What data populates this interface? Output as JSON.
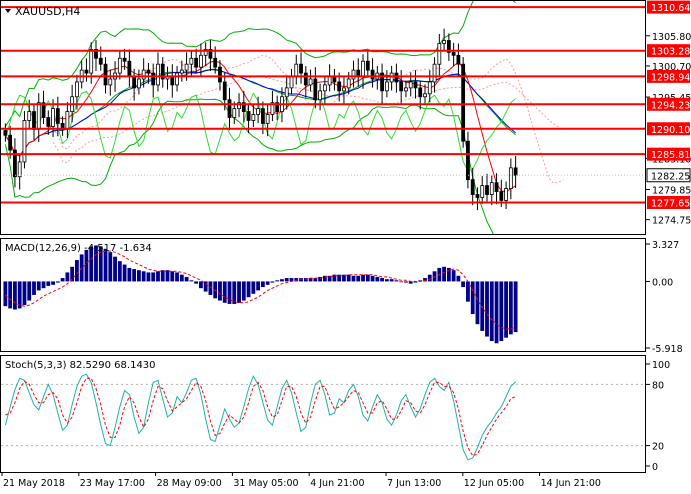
{
  "symbol_header": "XAUUSD,H4",
  "main_price_axis": {
    "ticks": [
      "1305.80",
      "1300.70",
      "1295.45",
      "1285.10",
      "1279.85",
      "1274.75"
    ]
  },
  "horizontal_levels": [
    {
      "price": 1310.64,
      "label": "1310.64"
    },
    {
      "price": 1303.28,
      "label": "1303.28"
    },
    {
      "price": 1298.94,
      "label": "1298.94"
    },
    {
      "price": 1294.23,
      "label": "1294.23"
    },
    {
      "price": 1290.1,
      "label": "1290.10"
    },
    {
      "price": 1285.81,
      "label": "1285.81"
    },
    {
      "price": 1277.65,
      "label": "1277.65"
    }
  ],
  "current_price": {
    "price": 1282.25,
    "label": "1282.25"
  },
  "macd": {
    "header": "MACD(12,26,9) -4.517 -1.634",
    "ticks": [
      "3.327",
      "0.00",
      "-5.918"
    ]
  },
  "stoch": {
    "header": "Stoch(5,3,3) 82.5290 68.1430",
    "ticks": [
      "100",
      "80",
      "20",
      "0"
    ]
  },
  "time_axis": [
    "21 May 2018",
    "23 May 17:00",
    "28 May 09:00",
    "31 May 05:00",
    "4 Jun 21:00",
    "7 Jun 13:00",
    "12 Jun 05:00",
    "14 Jun 21:00"
  ],
  "colors": {
    "level_line": "#ff0000",
    "current_price_box": "#ffffff",
    "bollinger": "#00b000",
    "ma_fast": "#ff0000",
    "ma_slow": "#0000ff",
    "ichimoku_cloud": "#ff9a9a",
    "green_indicator": "#33dd33",
    "macd_hist": "#00008b",
    "macd_signal": "#ff0000",
    "stoch_main": "#20b2aa",
    "stoch_signal": "#ff0000",
    "label_bg": "#ff0000",
    "label_text": "#ffffff",
    "candles": "#000000"
  },
  "chart_data": {
    "type": "candlestick",
    "main_ylim": [
      1272.5,
      1311.5
    ],
    "closes": [
      1289.0,
      1286.5,
      1282.0,
      1284.5,
      1291.5,
      1293.0,
      1290.0,
      1294.5,
      1292.0,
      1290.5,
      1293.5,
      1291.0,
      1290.0,
      1293.0,
      1295.5,
      1298.0,
      1300.0,
      1299.5,
      1303.5,
      1302.0,
      1301.0,
      1297.5,
      1298.5,
      1299.5,
      1302.0,
      1301.5,
      1299.0,
      1297.0,
      1298.5,
      1300.0,
      1299.5,
      1297.5,
      1301.0,
      1298.5,
      1299.0,
      1297.5,
      1299.5,
      1300.0,
      1301.0,
      1302.0,
      1300.5,
      1302.5,
      1303.5,
      1302.0,
      1300.5,
      1298.0,
      1295.0,
      1292.0,
      1293.5,
      1294.5,
      1293.0,
      1291.5,
      1292.5,
      1293.5,
      1291.0,
      1292.5,
      1294.5,
      1293.0,
      1295.5,
      1297.0,
      1299.0,
      1301.0,
      1299.5,
      1297.5,
      1298.5,
      1295.0,
      1296.5,
      1297.5,
      1299.0,
      1298.0,
      1296.5,
      1297.0,
      1298.5,
      1300.0,
      1299.0,
      1301.5,
      1300.0,
      1298.5,
      1299.5,
      1296.5,
      1298.0,
      1299.5,
      1298.0,
      1296.5,
      1297.0,
      1298.0,
      1297.0,
      1295.5,
      1296.0,
      1298.0,
      1301.0,
      1304.5,
      1305.0,
      1303.0,
      1302.5,
      1301.0,
      1288.0,
      1281.5,
      1279.0,
      1278.5,
      1280.5,
      1279.0,
      1281.0,
      1279.5,
      1278.0,
      1280.0,
      1283.5,
      1282.25
    ],
    "macd_hist": [
      -2.2,
      -2.4,
      -2.5,
      -2.4,
      -2.1,
      -1.7,
      -1.2,
      -0.8,
      -0.6,
      -0.4,
      -0.3,
      -0.1,
      0.3,
      0.8,
      1.3,
      1.9,
      2.4,
      2.8,
      3.1,
      3.2,
      3.1,
      2.9,
      2.6,
      2.2,
      1.8,
      1.5,
      1.2,
      1.1,
      1.0,
      0.9,
      0.8,
      0.8,
      0.9,
      1.0,
      1.0,
      0.9,
      0.8,
      0.6,
      0.4,
      0.1,
      -0.2,
      -0.6,
      -0.9,
      -1.2,
      -1.5,
      -1.7,
      -1.9,
      -2.0,
      -2.0,
      -1.9,
      -1.7,
      -1.4,
      -1.1,
      -0.8,
      -0.5,
      -0.3,
      -0.1,
      0.1,
      0.2,
      0.3,
      0.3,
      0.3,
      0.3,
      0.3,
      0.3,
      0.3,
      0.4,
      0.5,
      0.5,
      0.6,
      0.6,
      0.6,
      0.6,
      0.5,
      0.5,
      0.6,
      0.6,
      0.5,
      0.4,
      0.3,
      0.2,
      0.2,
      0.1,
      0.0,
      -0.1,
      -0.2,
      -0.1,
      0.1,
      0.3,
      0.6,
      0.9,
      1.2,
      1.3,
      1.2,
      1.0,
      0.5,
      -0.5,
      -1.8,
      -2.9,
      -3.8,
      -4.4,
      -4.9,
      -5.3,
      -5.5,
      -5.3,
      -5.0,
      -4.7,
      -4.5
    ],
    "macd_signal": [
      -1.2,
      -1.6,
      -1.9,
      -2.1,
      -2.2,
      -2.1,
      -1.9,
      -1.6,
      -1.3,
      -1.1,
      -0.9,
      -0.7,
      -0.5,
      -0.2,
      0.2,
      0.7,
      1.2,
      1.6,
      2.0,
      2.4,
      2.6,
      2.7,
      2.7,
      2.6,
      2.4,
      2.2,
      1.9,
      1.7,
      1.5,
      1.3,
      1.1,
      1.0,
      0.9,
      0.9,
      0.9,
      0.9,
      0.9,
      0.8,
      0.7,
      0.5,
      0.3,
      0.1,
      -0.2,
      -0.5,
      -0.8,
      -1.1,
      -1.4,
      -1.6,
      -1.8,
      -1.9,
      -1.9,
      -1.8,
      -1.6,
      -1.4,
      -1.1,
      -0.8,
      -0.6,
      -0.4,
      -0.2,
      -0.1,
      0.0,
      0.1,
      0.2,
      0.2,
      0.3,
      0.3,
      0.3,
      0.4,
      0.4,
      0.5,
      0.5,
      0.5,
      0.6,
      0.6,
      0.6,
      0.6,
      0.6,
      0.6,
      0.5,
      0.4,
      0.4,
      0.3,
      0.2,
      0.1,
      0.1,
      0.0,
      0.0,
      0.0,
      0.1,
      0.2,
      0.4,
      0.6,
      0.8,
      1.0,
      1.1,
      1.0,
      0.6,
      0.0,
      -0.8,
      -1.6,
      -2.3,
      -2.9,
      -3.4,
      -3.8,
      -4.1,
      -4.2,
      -4.2,
      -4.1
    ],
    "stoch_main": [
      40,
      58,
      75,
      86,
      84,
      72,
      60,
      55,
      68,
      80,
      70,
      52,
      35,
      40,
      60,
      78,
      88,
      90,
      82,
      62,
      40,
      22,
      20,
      38,
      58,
      74,
      70,
      48,
      32,
      38,
      62,
      82,
      84,
      66,
      48,
      52,
      68,
      62,
      72,
      84,
      86,
      70,
      46,
      26,
      24,
      40,
      56,
      46,
      38,
      42,
      58,
      76,
      88,
      80,
      62,
      45,
      40,
      58,
      76,
      84,
      72,
      52,
      34,
      38,
      62,
      80,
      84,
      70,
      50,
      52,
      66,
      62,
      74,
      80,
      68,
      50,
      44,
      58,
      70,
      62,
      46,
      40,
      50,
      64,
      70,
      58,
      48,
      56,
      70,
      82,
      86,
      78,
      74,
      82,
      64,
      40,
      16,
      6,
      8,
      18,
      30,
      38,
      44,
      52,
      58,
      68,
      78,
      82.5
    ],
    "stoch_signal": [
      50,
      52,
      62,
      76,
      83,
      80,
      70,
      62,
      62,
      70,
      72,
      66,
      50,
      42,
      48,
      62,
      78,
      86,
      86,
      76,
      60,
      40,
      28,
      28,
      40,
      58,
      68,
      62,
      48,
      38,
      46,
      64,
      78,
      76,
      64,
      54,
      58,
      62,
      66,
      74,
      82,
      78,
      64,
      44,
      30,
      32,
      42,
      50,
      46,
      42,
      48,
      62,
      78,
      82,
      74,
      58,
      48,
      50,
      64,
      78,
      78,
      68,
      52,
      42,
      48,
      64,
      78,
      78,
      66,
      56,
      58,
      62,
      68,
      74,
      72,
      62,
      52,
      52,
      62,
      64,
      56,
      46,
      46,
      54,
      64,
      62,
      54,
      52,
      60,
      72,
      82,
      82,
      78,
      78,
      72,
      56,
      34,
      18,
      10,
      12,
      20,
      30,
      38,
      46,
      52,
      58,
      66,
      68.1
    ]
  }
}
